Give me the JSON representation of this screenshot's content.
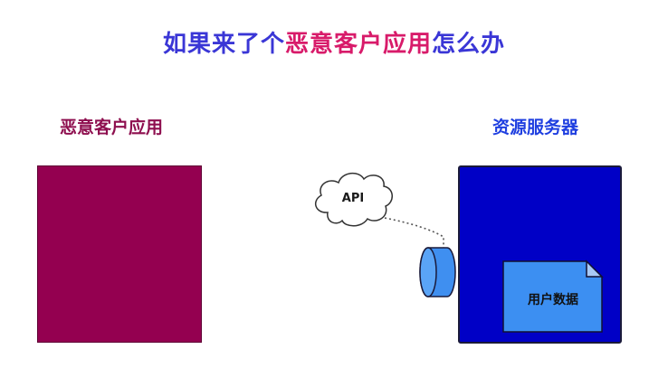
{
  "title": {
    "part1": "如果来了个",
    "part2": "恶意客户应用",
    "part3": "怎么办"
  },
  "labels": {
    "malicious_client": "恶意客户应用",
    "resource_server": "资源服务器",
    "api": "API",
    "user_data": "用户数据"
  },
  "colors": {
    "title_blue": "#3a36d6",
    "title_red": "#d81b6a",
    "malicious_fill": "#940050",
    "server_fill": "#0000c6",
    "endpoint_fill": "#3f8ff0",
    "document_fill": "#3c8ff2"
  }
}
